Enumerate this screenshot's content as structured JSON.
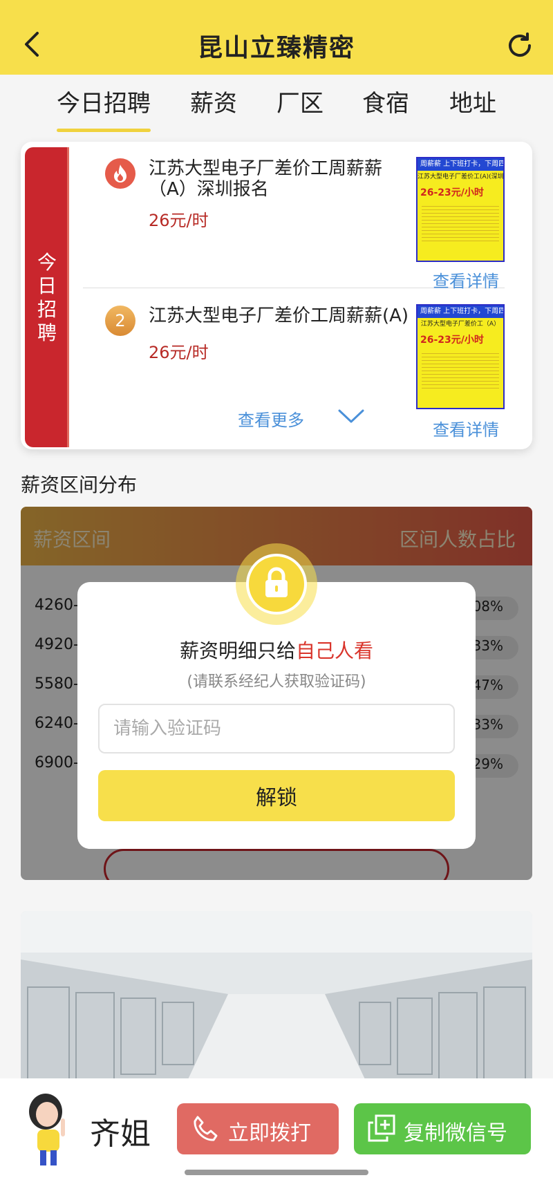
{
  "header": {
    "title": "昆山立臻精密",
    "back_icon": "chevron-left-icon",
    "refresh_icon": "refresh-icon"
  },
  "tabs": [
    {
      "label": "今日招聘",
      "active": true
    },
    {
      "label": "薪资"
    },
    {
      "label": "厂区"
    },
    {
      "label": "食宿"
    },
    {
      "label": "地址"
    }
  ],
  "jobs": {
    "ribbon": "今日招聘",
    "items": [
      {
        "rank_icon": "fire-icon",
        "title": "江苏大型电子厂差价工周薪薪（A）深圳报名",
        "wage": "26元/时",
        "poster": {
          "head": "周薪薪 上下班打卡，下周四拿钱",
          "sub": "江苏大型电子厂差价工(A)(深圳报名)",
          "price": "26-23元/小时"
        },
        "detail": "查看详情"
      },
      {
        "rank": "2",
        "title": "江苏大型电子厂差价工周薪薪(A)",
        "wage": "26元/时",
        "poster": {
          "head": "周薪薪 上下班打卡，下周四拿钱",
          "sub": "江苏大型电子厂差价工（A）",
          "price": "26-23元/小时"
        },
        "detail": "查看详情"
      }
    ],
    "more": "查看更多"
  },
  "salary": {
    "section_title": "薪资区间分布",
    "col_range": "薪资区间",
    "col_ratio": "区间人数占比",
    "rows": [
      {
        "range": "4260-",
        "pct": "08%"
      },
      {
        "range": "4920-",
        "pct": "33%"
      },
      {
        "range": "5580-",
        "pct": "47%"
      },
      {
        "range": "6240-",
        "pct": "33%"
      },
      {
        "range": "6900-",
        "pct": "29%"
      }
    ]
  },
  "modal": {
    "msg_prefix": "薪资明细只给",
    "msg_highlight": "自己人看",
    "sub": "(请联系经纪人获取验证码)",
    "input_placeholder": "请输入验证码",
    "input_value": "",
    "unlock_label": "解锁"
  },
  "bottom": {
    "agent_name": "齐姐",
    "call_label": "立即拨打",
    "wechat_label": "复制微信号"
  },
  "colors": {
    "brand_yellow": "#f7df4b",
    "accent_red": "#c9262d",
    "link_blue": "#4a90d9",
    "call_red": "#e06a63",
    "wechat_green": "#5cc548"
  }
}
